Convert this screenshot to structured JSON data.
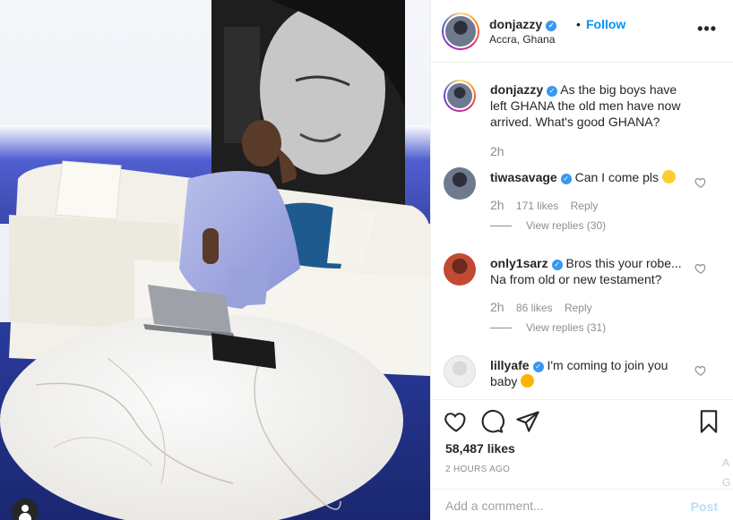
{
  "post": {
    "username": "donjazzy",
    "follow_label": "Follow",
    "location": "Accra, Ghana",
    "more_label": "•••",
    "caption": "As the big boys have left GHANA the old men have now arrived. What's good GHANA?",
    "caption_time": "2h"
  },
  "comments": [
    {
      "username": "tiwasavage",
      "text": "Can I come pls",
      "emoji": "sad-face",
      "time": "2h",
      "likes": "171 likes",
      "reply_label": "Reply",
      "view_replies": "View replies (30)"
    },
    {
      "username": "only1sarz",
      "text": "Bros this your robe... Na from old or new testament?",
      "time": "2h",
      "likes": "86 likes",
      "reply_label": "Reply",
      "view_replies": "View replies (31)"
    },
    {
      "username": "lillyafe",
      "text": "I'm coming to join you baby",
      "emoji": "heart-eyes-face"
    }
  ],
  "stats": {
    "likes": "58,487 likes",
    "posted": "2 HOURS AGO"
  },
  "add_comment": {
    "placeholder": "Add a comment...",
    "post_label": "Post"
  },
  "edge_ghost": {
    "line1": "A",
    "line2": "G"
  },
  "colors": {
    "accent_blue": "#0095f6",
    "verified": "#3897f0",
    "muted_text": "#8e8e8e",
    "post_disabled": "#b2dffc"
  },
  "icons": [
    "verified-badge",
    "heart-icon",
    "comment-icon",
    "share-icon",
    "bookmark-icon",
    "user-tag-icon",
    "more-options-icon"
  ]
}
